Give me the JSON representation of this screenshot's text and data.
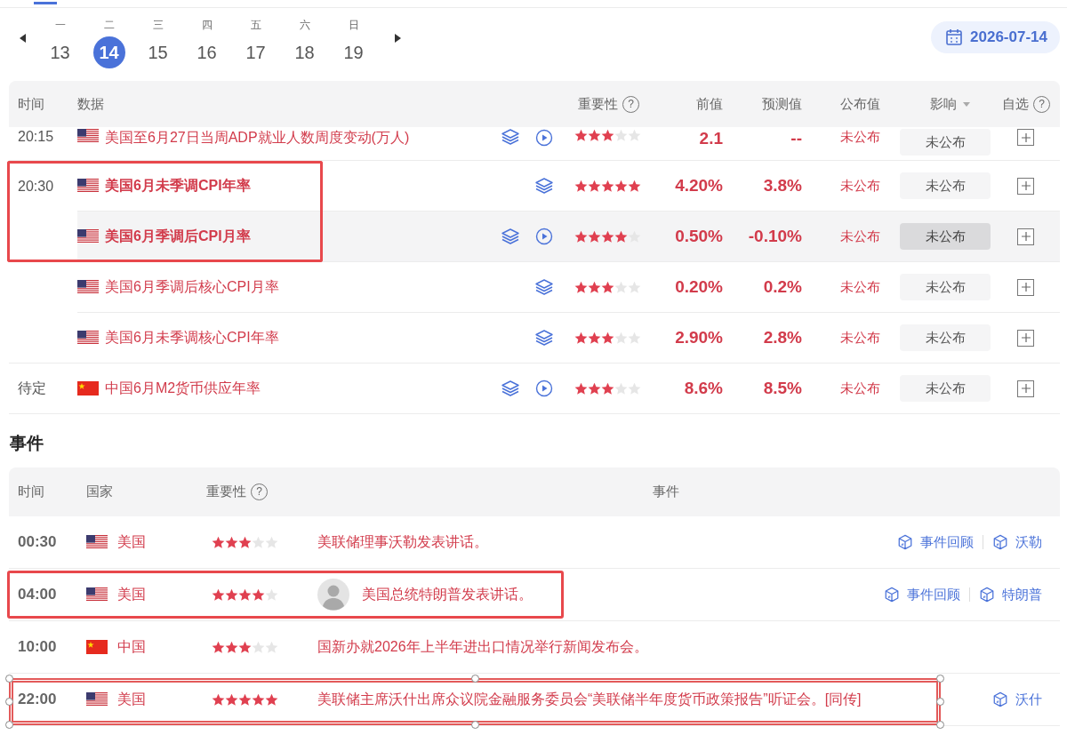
{
  "week": {
    "days": [
      {
        "weekday": "一",
        "day": "13",
        "selected": false
      },
      {
        "weekday": "二",
        "day": "14",
        "selected": true
      },
      {
        "weekday": "三",
        "day": "15",
        "selected": false
      },
      {
        "weekday": "四",
        "day": "16",
        "selected": false
      },
      {
        "weekday": "五",
        "day": "17",
        "selected": false
      },
      {
        "weekday": "六",
        "day": "18",
        "selected": false
      },
      {
        "weekday": "日",
        "day": "19",
        "selected": false
      }
    ]
  },
  "date_picker": {
    "value": "2026-07-14"
  },
  "data_table": {
    "columns": [
      {
        "label": "时间"
      },
      {
        "label": "数据"
      },
      {
        "label": "重要性",
        "help": "?"
      },
      {
        "label": "前值"
      },
      {
        "label": "预测值"
      },
      {
        "label": "公布值"
      },
      {
        "label": "影响",
        "sortable": true
      },
      {
        "label": "自选",
        "help": "?"
      }
    ],
    "rows": [
      {
        "time": "20:15",
        "flag": {
          "kind": "us"
        },
        "name": "美国至6月27日当周ADP就业人数周度变动(万人)",
        "bold": false,
        "video": true,
        "stars": 3,
        "previous": "2.1",
        "forecast": "--",
        "actual": "未公布",
        "impact": "未公布",
        "hovered": false
      },
      {
        "time": "20:30",
        "flag": {
          "kind": "us"
        },
        "name": "美国6月未季调CPI年率",
        "bold": true,
        "video": false,
        "stars": 5,
        "previous": "4.20%",
        "forecast": "3.8%",
        "actual": "未公布",
        "impact": "未公布",
        "hovered": false,
        "highlight": {
          "kind": "box"
        }
      },
      {
        "flag": {
          "kind": "us"
        },
        "name": "美国6月季调后CPI月率",
        "bold": true,
        "video": true,
        "stars": 4,
        "previous": "0.50%",
        "forecast": "-0.10%",
        "actual": "未公布",
        "impact": "未公布",
        "hovered": true,
        "highlight": {
          "kind": "box"
        }
      },
      {
        "flag": {
          "kind": "us"
        },
        "name": "美国6月季调后核心CPI月率",
        "bold": false,
        "video": false,
        "stars": 3,
        "previous": "0.20%",
        "forecast": "0.2%",
        "actual": "未公布",
        "impact": "未公布",
        "hovered": false
      },
      {
        "flag": {
          "kind": "us"
        },
        "name": "美国6月未季调核心CPI年率",
        "bold": false,
        "video": false,
        "stars": 3,
        "previous": "2.90%",
        "forecast": "2.8%",
        "actual": "未公布",
        "impact": "未公布",
        "hovered": false
      },
      {
        "time": "待定",
        "flag": {
          "kind": "cn"
        },
        "name": "中国6月M2货币供应年率",
        "bold": false,
        "video": true,
        "stars": 3,
        "previous": "8.6%",
        "forecast": "8.5%",
        "actual": "未公布",
        "impact": "未公布",
        "hovered": false
      }
    ]
  },
  "events": {
    "title": "事件",
    "columns": [
      {
        "label": "时间"
      },
      {
        "label": "国家"
      },
      {
        "label": "重要性",
        "help": "?"
      },
      {
        "label": "事件"
      }
    ],
    "rows": [
      {
        "time": "00:30",
        "flag": {
          "kind": "us"
        },
        "country_name": "美国",
        "stars": 3,
        "avatar": false,
        "text": "美联储理事沃勒发表讲话。",
        "links": [
          {
            "label": "事件回顾"
          },
          {
            "label": "沃勒"
          }
        ]
      },
      {
        "time": "04:00",
        "flag": {
          "kind": "us"
        },
        "country_name": "美国",
        "stars": 4,
        "avatar": true,
        "text": "美国总统特朗普发表讲话。",
        "links": [
          {
            "label": "事件回顾"
          },
          {
            "label": "特朗普"
          }
        ],
        "highlight": {
          "kind": "box"
        }
      },
      {
        "time": "10:00",
        "flag": {
          "kind": "cn"
        },
        "country_name": "中国",
        "stars": 3,
        "avatar": false,
        "text": "国新办就2026年上半年进出口情况举行新闻发布会。",
        "links": []
      },
      {
        "time": "22:00",
        "flag": {
          "kind": "us"
        },
        "country_name": "美国",
        "stars": 5,
        "avatar": false,
        "text": "美联储主席沃什出席众议院金融服务委员会“美联储半年度货币政策报告”听证会。[同传]",
        "links": [
          {
            "label": "沃什"
          }
        ],
        "highlight": {
          "kind": "selection"
        }
      }
    ]
  }
}
